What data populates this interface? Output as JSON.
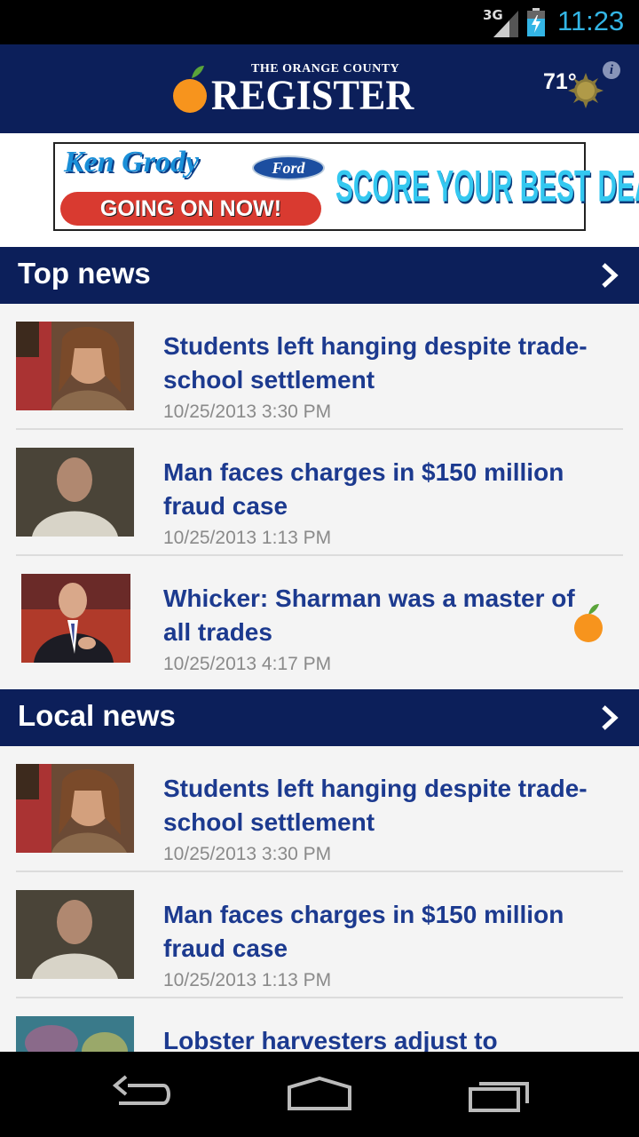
{
  "status_bar": {
    "network": "3G",
    "time": "11:23",
    "time_color": "#33b5e5"
  },
  "header": {
    "logo_small": "THE ORANGE COUNTY",
    "logo_main": "REGISTER",
    "weather_temp": "71°",
    "weather_icon": "sun-icon",
    "info_icon": "info-icon",
    "brand_color": "#0c1f5a"
  },
  "ad": {
    "brand": "Ken Grody",
    "badge": "Ford",
    "cta": "GOING ON NOW!",
    "tagline": "SCORE YOUR BEST DEAL!"
  },
  "sections": [
    {
      "title": "Top news",
      "items": [
        {
          "headline": "Students left hanging despite trade-school settlement",
          "date": "10/25/2013 3:30 PM"
        },
        {
          "headline": "Man faces charges in $150 million fraud case",
          "date": "10/25/2013 1:13 PM"
        },
        {
          "headline": "Whicker: Sharman was a master of all trades",
          "date": "10/25/2013 4:17 PM",
          "badge": "orange-icon"
        }
      ]
    },
    {
      "title": "Local news",
      "items": [
        {
          "headline": "Students left hanging despite trade-school settlement",
          "date": "10/25/2013 3:30 PM"
        },
        {
          "headline": "Man faces charges in $150 million fraud case",
          "date": "10/25/2013 1:13 PM"
        },
        {
          "headline": "Lobster harvesters adjust to",
          "date": ""
        }
      ]
    }
  ],
  "nav": {
    "back_icon": "back-icon",
    "home_icon": "home-icon",
    "recents_icon": "recents-icon"
  }
}
